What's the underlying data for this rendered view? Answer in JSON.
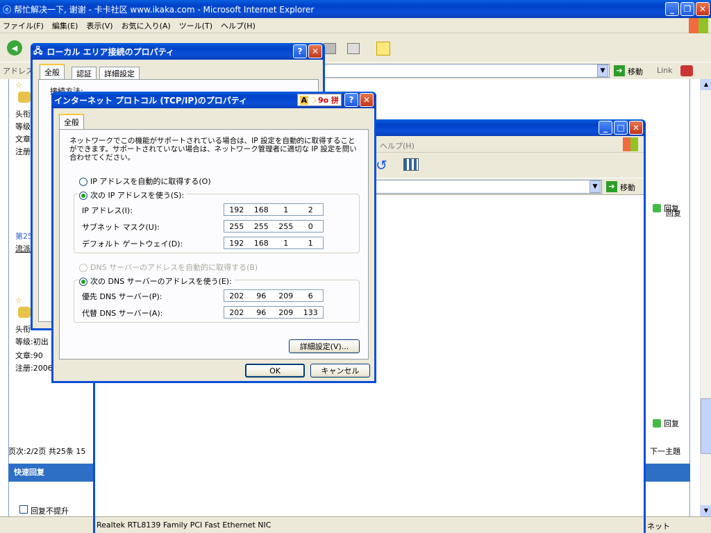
{
  "ie": {
    "title": "帮忙解决一下, 谢谢 - 卡卡社区 www.ikaka.com - Microsoft Internet Explorer",
    "menu": [
      "ファイル(F)",
      "編集(E)",
      "表示(V)",
      "お気に入り(A)",
      "ツール(T)",
      "ヘルプ(H)"
    ],
    "address_label": "アドレス",
    "go_label": "移動",
    "links_label": "Link",
    "forum": {
      "posts": [
        {
          "role": "头衔",
          "level": "等级",
          "articles": "文章",
          "reg": "注册"
        },
        {
          "role": "头衔",
          "level": "等级:初出",
          "articles": "文章:90",
          "reg": "注册:2006"
        }
      ],
      "floor_label": "第25",
      "flow_label": "流派",
      "reply_label": "回复",
      "pager": "页次:2/2页 共25条 15",
      "next_topic": "下一主題",
      "quick_reply": "快速回复",
      "no_bump_label": "回复不提升"
    },
    "status_zone": "ネット"
  },
  "inner_ie": {
    "menu_help": "ヘルプ(H)",
    "go_label": "移動",
    "reply_label": "回复",
    "status_text": "Realtek RTL8139 Family PCI Fast Ethernet NIC"
  },
  "lan": {
    "title": "ローカル エリア接続のプロパティ",
    "tabs": [
      "全般",
      "認証",
      "詳細設定"
    ],
    "connect_label": "接続方法:"
  },
  "tcpip": {
    "title": "インターネット プロトコル (TCP/IP)のプロパティ",
    "ime_text": "9o 拼",
    "tab": "全般",
    "description": "ネットワークでこの機能がサポートされている場合は、IP 設定を自動的に取得することができます。サポートされていない場合は、ネットワーク管理者に適切な IP 設定を問い合わせてください。",
    "auto_ip_label": "IP アドレスを自動的に取得する(O)",
    "manual_ip_label": "次の IP アドレスを使う(S):",
    "ip_label": "IP アドレス(I):",
    "ip": [
      "192",
      "168",
      "1",
      "2"
    ],
    "mask_label": "サブネット マスク(U):",
    "mask": [
      "255",
      "255",
      "255",
      "0"
    ],
    "gateway_label": "デフォルト ゲートウェイ(D):",
    "gateway": [
      "192",
      "168",
      "1",
      "1"
    ],
    "auto_dns_label": "DNS サーバーのアドレスを自動的に取得する(B)",
    "manual_dns_label": "次の DNS サーバーのアドレスを使う(E):",
    "preferred_dns_label": "優先 DNS サーバー(P):",
    "preferred_dns": [
      "202",
      "96",
      "209",
      "6"
    ],
    "alternate_dns_label": "代替 DNS サーバー(A):",
    "alternate_dns": [
      "202",
      "96",
      "209",
      "133"
    ],
    "advanced_label": "詳細設定(V)...",
    "ok_label": "OK",
    "cancel_label": "キャンセル"
  }
}
